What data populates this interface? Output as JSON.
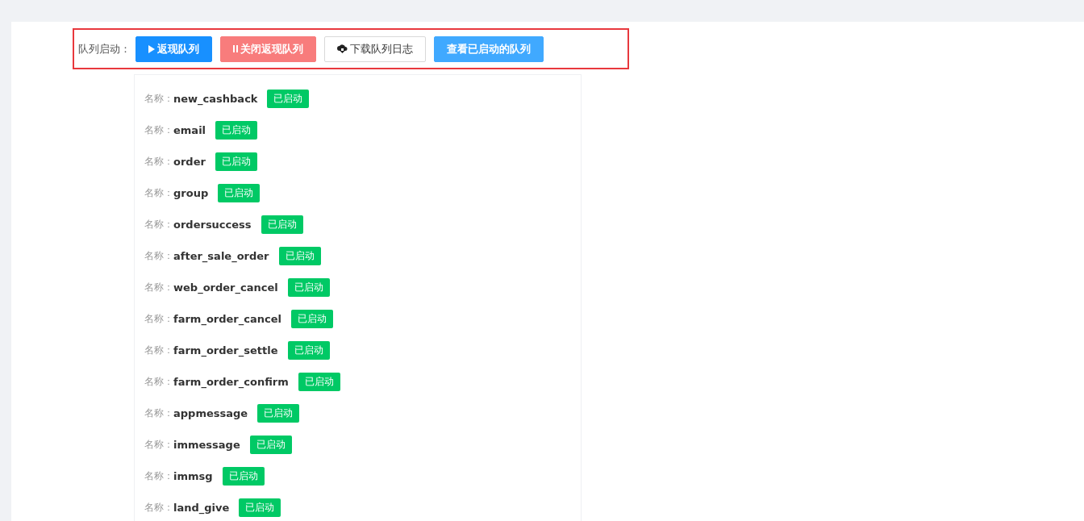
{
  "toolbar": {
    "label": "队列启动：",
    "buttons": [
      {
        "kind": "primary",
        "label": "返现队列"
      },
      {
        "kind": "danger",
        "label": "关闭返现队列"
      },
      {
        "kind": "default",
        "label": "下载队列日志"
      },
      {
        "kind": "info",
        "label": "查看已启动的队列"
      }
    ]
  },
  "queues": [
    {
      "label": "名称：",
      "name": "new_cashback",
      "status": "已启动"
    },
    {
      "label": "名称：",
      "name": "email",
      "status": "已启动"
    },
    {
      "label": "名称：",
      "name": "order",
      "status": "已启动"
    },
    {
      "label": "名称：",
      "name": "group",
      "status": "已启动"
    },
    {
      "label": "名称：",
      "name": "ordersuccess",
      "status": "已启动"
    },
    {
      "label": "名称：",
      "name": "after_sale_order",
      "status": "已启动"
    },
    {
      "label": "名称：",
      "name": "web_order_cancel",
      "status": "已启动"
    },
    {
      "label": "名称：",
      "name": "farm_order_cancel",
      "status": "已启动"
    },
    {
      "label": "名称：",
      "name": "farm_order_settle",
      "status": "已启动"
    },
    {
      "label": "名称：",
      "name": "farm_order_confirm",
      "status": "已启动"
    },
    {
      "label": "名称：",
      "name": "appmessage",
      "status": "已启动"
    },
    {
      "label": "名称：",
      "name": "immessage",
      "status": "已启动"
    },
    {
      "label": "名称：",
      "name": "immsg",
      "status": "已启动"
    },
    {
      "label": "名称：",
      "name": "land_give",
      "status": "已启动"
    }
  ]
}
